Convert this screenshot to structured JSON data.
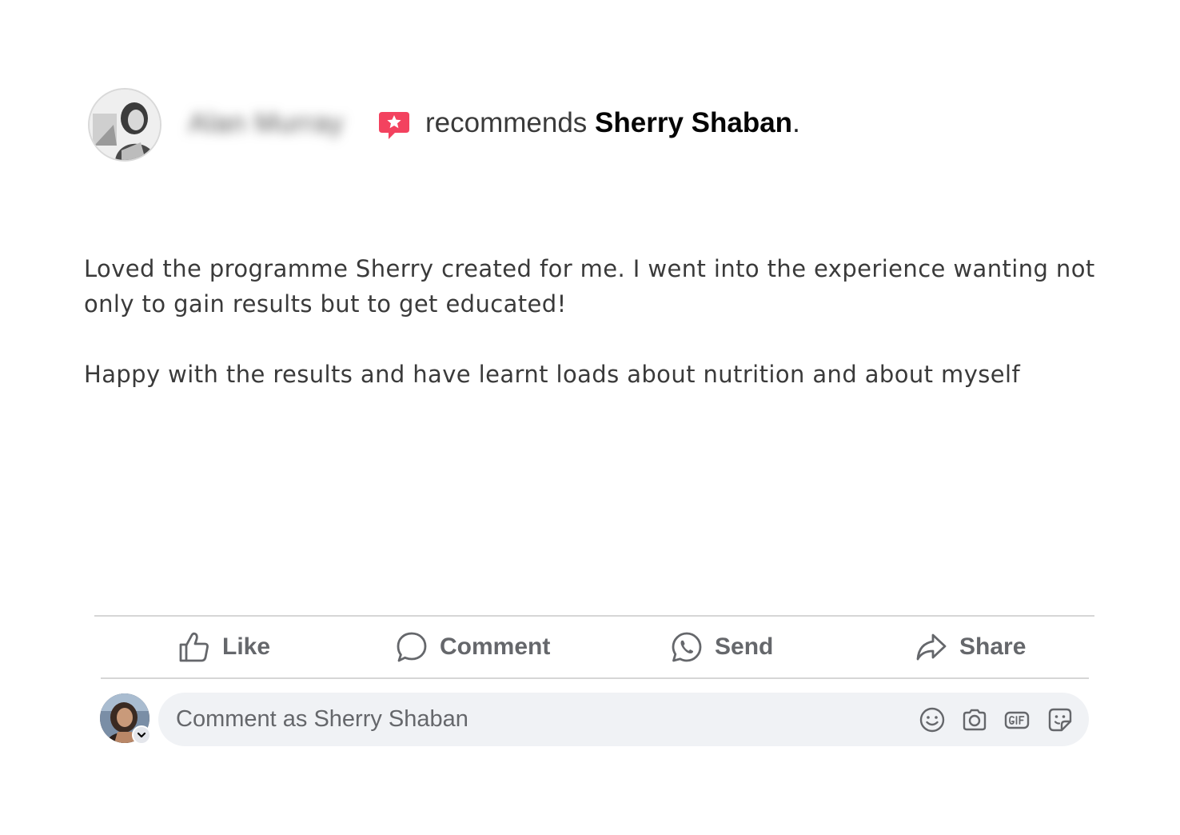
{
  "header": {
    "reviewer_name": "Alan Murray",
    "verb": "recommends",
    "page_name": "Sherry Shaban",
    "end_punct": ".",
    "badge_color": "#f3425f"
  },
  "review": {
    "paragraphs": [
      "Loved the programme Sherry created for me. I went into the experience wanting not only to gain results but to get educated!",
      "Happy with the results and have learnt loads about nutrition and about myself"
    ]
  },
  "actions": {
    "like": "Like",
    "comment": "Comment",
    "send": "Send",
    "share": "Share",
    "icon_color": "#65676b"
  },
  "composer": {
    "placeholder": "Comment as Sherry Shaban",
    "tools": [
      "emoji-icon",
      "camera-icon",
      "gif-icon",
      "sticker-icon"
    ]
  }
}
